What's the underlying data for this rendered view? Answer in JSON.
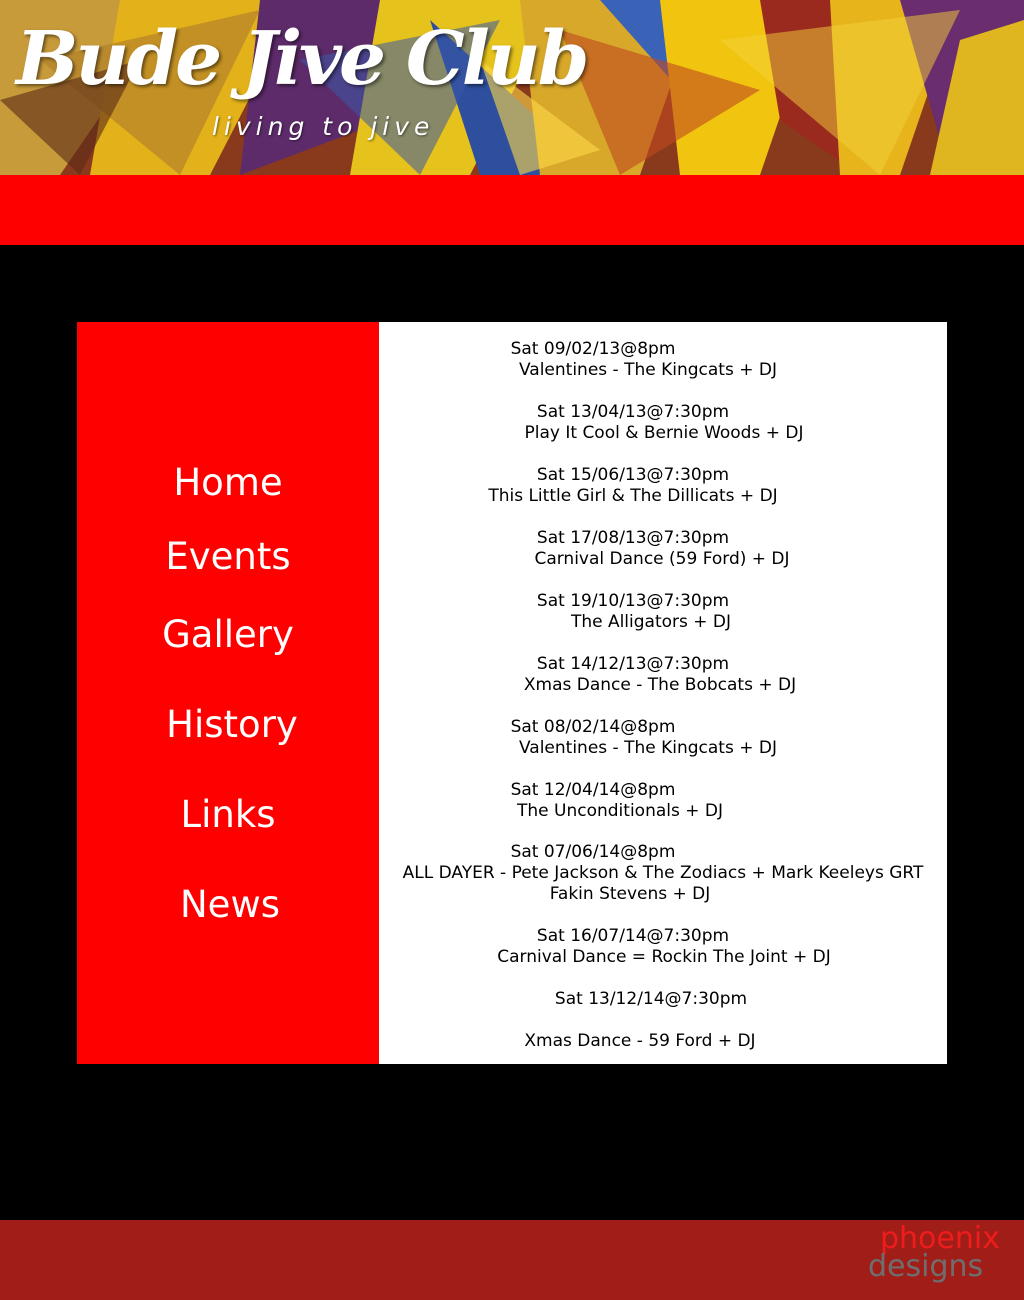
{
  "header": {
    "logo_title": "Bude Jive Club",
    "logo_tagline": "living to jive"
  },
  "nav": {
    "items": [
      {
        "label": "Home"
      },
      {
        "label": "Events"
      },
      {
        "label": "Gallery"
      },
      {
        "label": "History"
      },
      {
        "label": "Links"
      },
      {
        "label": "News"
      }
    ]
  },
  "events": [
    {
      "date": "Sat 09/02/13@8pm",
      "title": "Valentines - The Kingcats + DJ"
    },
    {
      "date": "Sat 13/04/13@7:30pm",
      "title": "Play It Cool & Bernie Woods + DJ"
    },
    {
      "date": "Sat 15/06/13@7:30pm",
      "title": "This Little Girl & The Dillicats + DJ"
    },
    {
      "date": "Sat 17/08/13@7:30pm",
      "title": "Carnival Dance (59 Ford) + DJ"
    },
    {
      "date": "Sat 19/10/13@7:30pm",
      "title": "The Alligators + DJ"
    },
    {
      "date": "Sat 14/12/13@7:30pm",
      "title": "Xmas Dance - The Bobcats + DJ"
    },
    {
      "date": "Sat 08/02/14@8pm",
      "title": "Valentines - The Kingcats + DJ"
    },
    {
      "date": "Sat 12/04/14@8pm",
      "title": "The Unconditionals + DJ"
    },
    {
      "date": "Sat 07/06/14@8pm",
      "title": "ALL DAYER - Pete Jackson & The Zodiacs + Mark Keeleys GRT",
      "title_2": "Fakin Stevens + DJ"
    },
    {
      "date": "Sat 16/07/14@7:30pm",
      "title": "Carnival Dance = Rockin The Joint + DJ"
    },
    {
      "date": "Sat 13/12/14@7:30pm",
      "title": "Xmas Dance - 59 Ford + DJ"
    }
  ],
  "footer": {
    "credit_line1": "phoenix",
    "credit_line2": "designs"
  },
  "colors": {
    "accent_red": "#fe0000",
    "footer_red": "#a11e18",
    "background": "#000000",
    "panel": "#ffffff"
  }
}
